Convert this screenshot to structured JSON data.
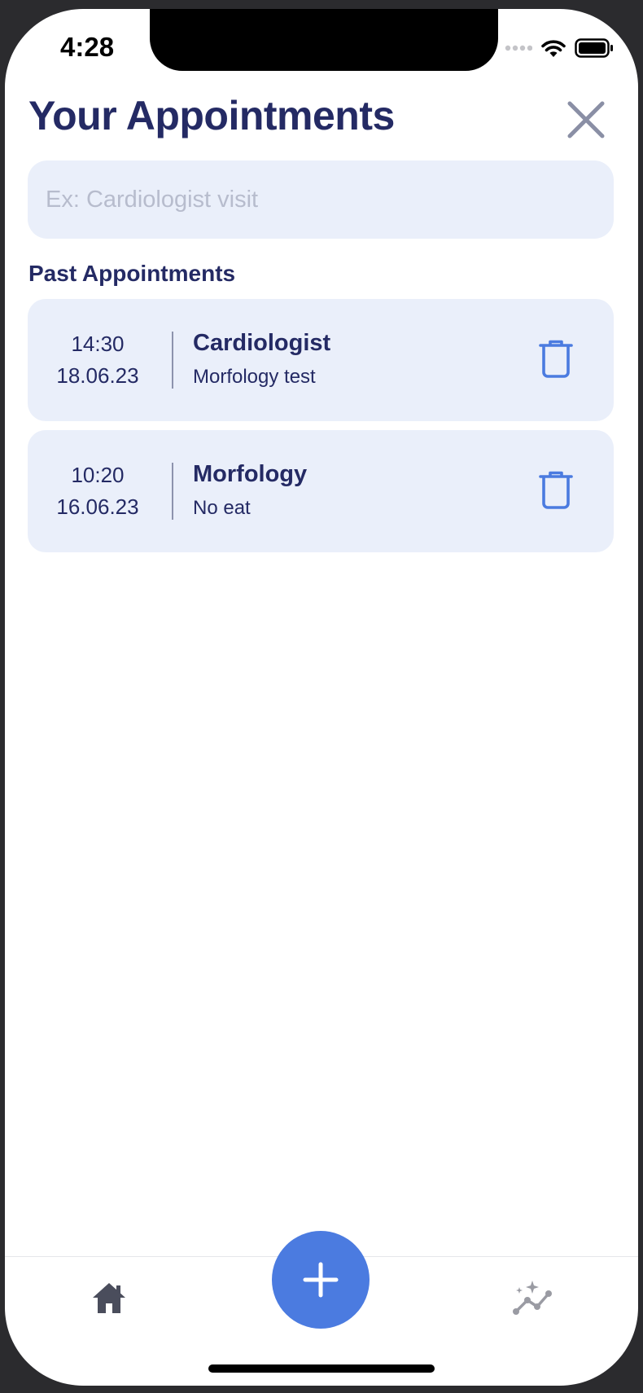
{
  "status_bar": {
    "time": "4:28"
  },
  "header": {
    "title": "Your Appointments",
    "close_icon": "close-icon"
  },
  "search": {
    "placeholder": "Ex: Cardiologist visit",
    "value": ""
  },
  "past_section": {
    "title": "Past Appointments",
    "items": [
      {
        "time": "14:30",
        "date": "18.06.23",
        "title": "Cardiologist",
        "subtitle": "Morfology test",
        "action_icon": "trash-icon"
      },
      {
        "time": "10:20",
        "date": "16.06.23",
        "title": "Morfology",
        "subtitle": "No eat",
        "action_icon": "trash-icon"
      }
    ]
  },
  "tab_bar": {
    "home_icon": "home-icon",
    "add_icon": "plus-icon",
    "stats_icon": "analytics-icon"
  },
  "colors": {
    "primary_text": "#242a64",
    "card_background": "#eaeffa",
    "accent": "#4b7be0"
  }
}
